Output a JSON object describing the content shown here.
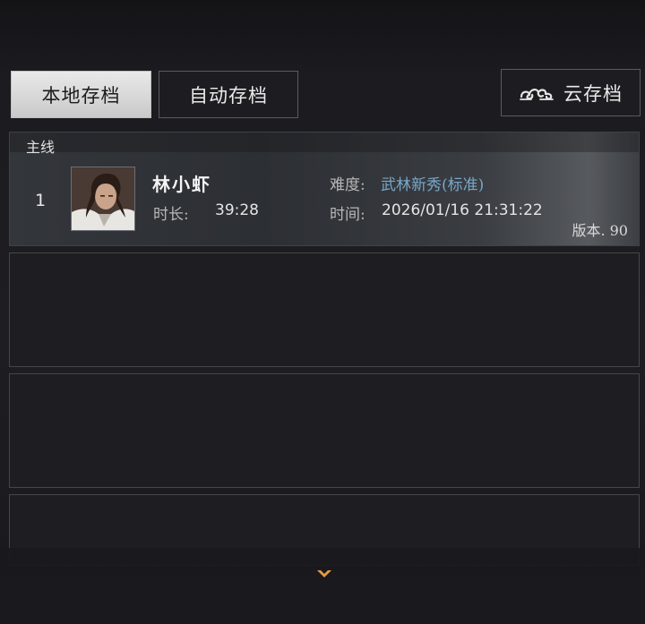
{
  "tabs": {
    "local": "本地存档",
    "auto": "自动存档",
    "cloud": "云存档",
    "cloud_icon": "auspicious-cloud-icon"
  },
  "save_list": {
    "category": "主线",
    "slots": [
      {
        "index": "1",
        "character_name": "林小虾",
        "duration_label": "时长:",
        "duration_value": "39:28",
        "difficulty_label": "难度:",
        "difficulty_value": "武林新秀(标准)",
        "time_label": "时间:",
        "time_value": "2026/01/16 21:31:22",
        "version": "版本. 90"
      }
    ],
    "empty_slot_count": 3
  },
  "scroll": {
    "icon": "chevron-down-icon"
  },
  "colors": {
    "difficulty_text": "#79a8c9",
    "scroll_arrow": "#e39b45",
    "active_tab_bg": "#e0e0e0"
  }
}
